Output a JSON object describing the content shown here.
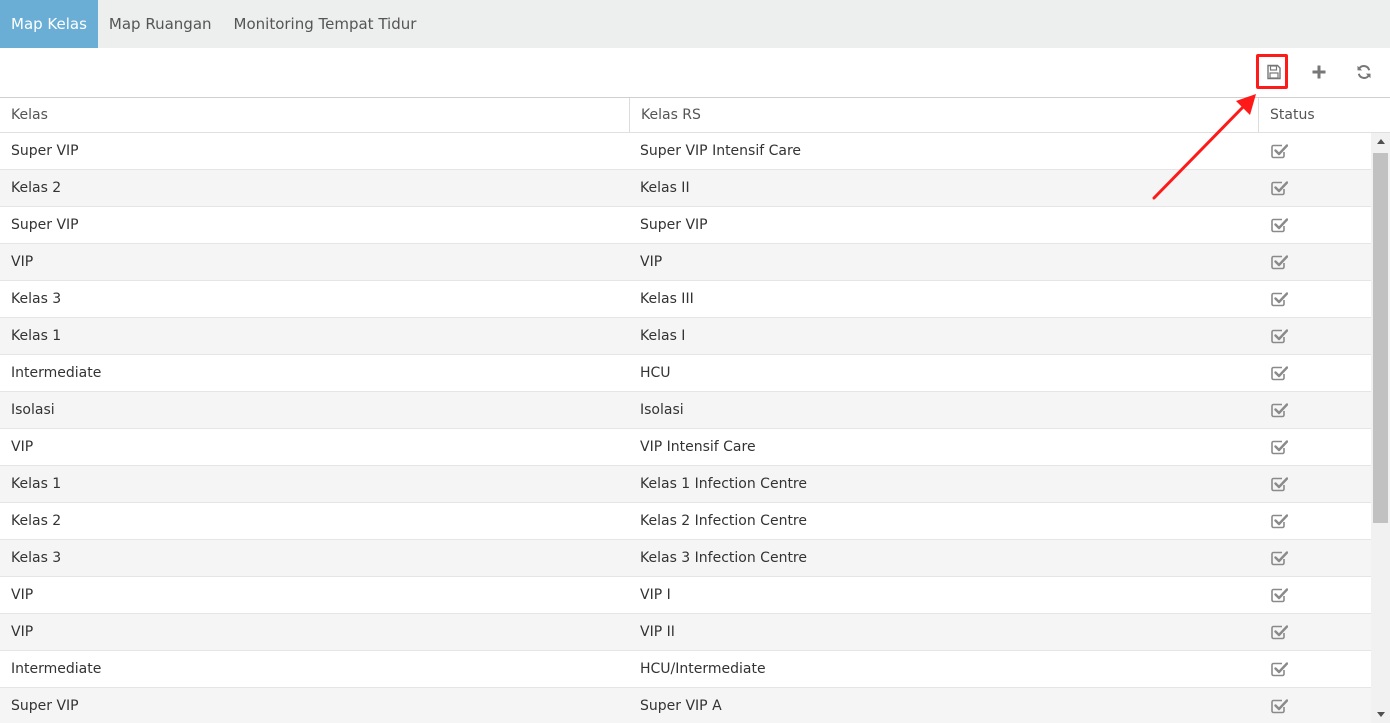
{
  "tabs": [
    {
      "label": "Map Kelas",
      "active": true
    },
    {
      "label": "Map Ruangan",
      "active": false
    },
    {
      "label": "Monitoring Tempat Tidur",
      "active": false
    }
  ],
  "toolbar": {
    "save_icon": "save-icon",
    "add_icon": "plus-icon",
    "refresh_icon": "refresh-icon"
  },
  "table": {
    "columns": [
      "Kelas",
      "Kelas RS",
      "Status"
    ],
    "rows": [
      {
        "kelas": "Super VIP",
        "kelas_rs": "Super VIP Intensif Care",
        "status": true
      },
      {
        "kelas": "Kelas 2",
        "kelas_rs": "Kelas II",
        "status": true
      },
      {
        "kelas": "Super VIP",
        "kelas_rs": "Super VIP",
        "status": true
      },
      {
        "kelas": "VIP",
        "kelas_rs": "VIP",
        "status": true
      },
      {
        "kelas": "Kelas 3",
        "kelas_rs": "Kelas III",
        "status": true
      },
      {
        "kelas": "Kelas 1",
        "kelas_rs": "Kelas I",
        "status": true
      },
      {
        "kelas": "Intermediate",
        "kelas_rs": "HCU",
        "status": true
      },
      {
        "kelas": "Isolasi",
        "kelas_rs": "Isolasi",
        "status": true
      },
      {
        "kelas": "VIP",
        "kelas_rs": "VIP Intensif Care",
        "status": true
      },
      {
        "kelas": "Kelas 1",
        "kelas_rs": "Kelas 1 Infection Centre",
        "status": true
      },
      {
        "kelas": "Kelas 2",
        "kelas_rs": "Kelas 2 Infection Centre",
        "status": true
      },
      {
        "kelas": "Kelas 3",
        "kelas_rs": "Kelas 3 Infection Centre",
        "status": true
      },
      {
        "kelas": "VIP",
        "kelas_rs": "VIP I",
        "status": true
      },
      {
        "kelas": "VIP",
        "kelas_rs": "VIP II",
        "status": true
      },
      {
        "kelas": "Intermediate",
        "kelas_rs": "HCU/Intermediate",
        "status": true
      },
      {
        "kelas": "Super VIP",
        "kelas_rs": "Super VIP A",
        "status": true
      }
    ]
  },
  "colors": {
    "active_tab": "#6aaed6",
    "tab_bar": "#ecefee",
    "highlight": "#ff1a1a",
    "alt_row": "#f5f5f5"
  }
}
